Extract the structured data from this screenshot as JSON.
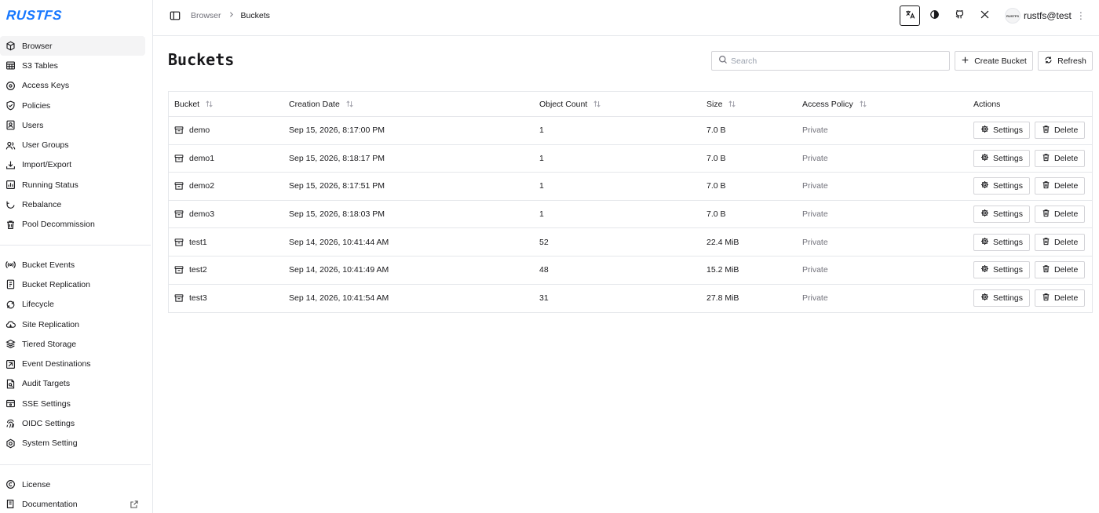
{
  "app": {
    "logo": "RUSTFS"
  },
  "sidebar": {
    "group1": [
      {
        "label": "Browser",
        "icon": "cube-icon",
        "active": true
      },
      {
        "label": "S3 Tables",
        "icon": "table-icon"
      },
      {
        "label": "Access Keys",
        "icon": "key-icon"
      },
      {
        "label": "Policies",
        "icon": "shield-icon"
      },
      {
        "label": "Users",
        "icon": "user-icon"
      },
      {
        "label": "User Groups",
        "icon": "users-icon"
      },
      {
        "label": "Import/Export",
        "icon": "import-icon"
      },
      {
        "label": "Running Status",
        "icon": "chart-icon"
      },
      {
        "label": "Rebalance",
        "icon": "refresh-icon"
      },
      {
        "label": "Pool Decommission",
        "icon": "trash-icon"
      }
    ],
    "group2": [
      {
        "label": "Bucket Events",
        "icon": "broadcast-icon"
      },
      {
        "label": "Bucket Replication",
        "icon": "copy-icon"
      },
      {
        "label": "Lifecycle",
        "icon": "lifecycle-icon"
      },
      {
        "label": "Site Replication",
        "icon": "cloud-icon"
      },
      {
        "label": "Tiered Storage",
        "icon": "layers-icon"
      },
      {
        "label": "Event Destinations",
        "icon": "destination-icon"
      },
      {
        "label": "Audit Targets",
        "icon": "audit-icon"
      },
      {
        "label": "SSE Settings",
        "icon": "lock-icon"
      },
      {
        "label": "OIDC Settings",
        "icon": "fingerprint-icon"
      },
      {
        "label": "System Setting",
        "icon": "gear-icon"
      }
    ],
    "group3": [
      {
        "label": "License",
        "icon": "copyright-icon"
      },
      {
        "label": "Documentation",
        "icon": "book-icon",
        "external": true
      }
    ]
  },
  "header": {
    "breadcrumb": [
      "Browser",
      "Buckets"
    ],
    "user": "rustfs@test",
    "avatar_text": "RUSTFS"
  },
  "page": {
    "title": "Buckets",
    "search_placeholder": "Search",
    "create_label": "Create Bucket",
    "refresh_label": "Refresh"
  },
  "table": {
    "columns": [
      "Bucket",
      "Creation Date",
      "Object Count",
      "Size",
      "Access Policy",
      "Actions"
    ],
    "rows": [
      {
        "bucket": "demo",
        "date": "Sep 15, 2026, 8:17:00 PM",
        "count": "1",
        "size": "7.0 B",
        "policy": "Private"
      },
      {
        "bucket": "demo1",
        "date": "Sep 15, 2026, 8:18:17 PM",
        "count": "1",
        "size": "7.0 B",
        "policy": "Private"
      },
      {
        "bucket": "demo2",
        "date": "Sep 15, 2026, 8:17:51 PM",
        "count": "1",
        "size": "7.0 B",
        "policy": "Private"
      },
      {
        "bucket": "demo3",
        "date": "Sep 15, 2026, 8:18:03 PM",
        "count": "1",
        "size": "7.0 B",
        "policy": "Private"
      },
      {
        "bucket": "test1",
        "date": "Sep 14, 2026, 10:41:44 AM",
        "count": "52",
        "size": "22.4 MiB",
        "policy": "Private"
      },
      {
        "bucket": "test2",
        "date": "Sep 14, 2026, 10:41:49 AM",
        "count": "48",
        "size": "15.2 MiB",
        "policy": "Private"
      },
      {
        "bucket": "test3",
        "date": "Sep 14, 2026, 10:41:54 AM",
        "count": "31",
        "size": "27.8 MiB",
        "policy": "Private"
      }
    ],
    "settings_label": "Settings",
    "delete_label": "Delete"
  },
  "colors": {
    "brand": "#1677ff",
    "border": "#e5e7eb",
    "muted": "#71717a"
  }
}
